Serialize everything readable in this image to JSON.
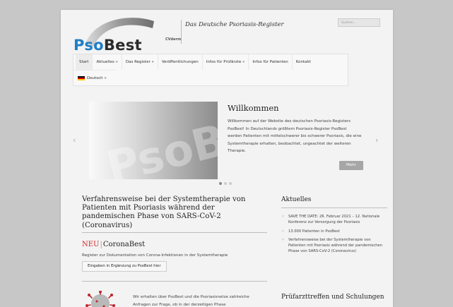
{
  "header": {
    "logo_pso": "Pso",
    "logo_best": "Best",
    "logo_sub": "CVderm",
    "tagline": "Das Deutsche Psoriasis-Register",
    "search_placeholder": "Suchen..."
  },
  "nav": {
    "items": [
      {
        "label": "Start"
      },
      {
        "label": "Aktuelles »"
      },
      {
        "label": "Das Register »"
      },
      {
        "label": "Veröffentlichungen"
      },
      {
        "label": "Infos für Prüfärzte »"
      },
      {
        "label": "Infos für Patienten"
      },
      {
        "label": "Kontakt"
      }
    ],
    "language": "Deutsch »"
  },
  "slider": {
    "image_text": "PsoBest",
    "title": "Willkommen",
    "text": "Willkommen auf der Website des deutschen Psoriasis-Registers PsoBest! In Deutschlands größtem Psoriasis-Register PsoBest werden Patienten mit mittelschwerer bis schwerer Psoriasis, die eine Systemtherapie erhalten, beobachtet, ungeachtet der weiteren Therapie.",
    "more_label": "Mehr",
    "prev_arrow": "‹",
    "next_arrow": "›",
    "slide_count": 3,
    "active_slide": 1
  },
  "main": {
    "article_title": "Verfahrensweise bei der Systemtherapie von Patienten mit Psoriasis während der pandemischen Phase von SARS-CoV-2 (Coronavirus)",
    "neu_label": "NEU",
    "neu_separator": "|",
    "neu_title": "CoronaBest",
    "neu_text": "Register zur Dokumentation von Corona-Infektionen in der Systemtherapie",
    "register_button": "Eingaben in Ergänzung zu PsoBest hier",
    "virus_text": "Wir erhalten über PsoBest und die Psoriasisnetze zahlreiche Anfragen zur Frage, ob in der derzeitigen Phase"
  },
  "sidebar": {
    "news_heading": "Aktuelles",
    "news": [
      "SAVE THE DATE: 26. Februar 2021 – 12. Nationale Konferenz zur Versorgung der Psoriasis",
      "13.000 Patienten in PsoBest",
      "Verfahrensweise bei der Systemtherapie von Patienten mit Psoriasis während der pandemischen Phase von SARS-CoV-2 (Coronavirus)"
    ],
    "training_heading": "Prüfarzttreffen und Schulungen"
  },
  "colors": {
    "pso_blue": "#1e7fc6",
    "neu_red": "#d2232a",
    "page_bg": "#f3f3f3",
    "outer_bg": "#c7c7c7"
  }
}
